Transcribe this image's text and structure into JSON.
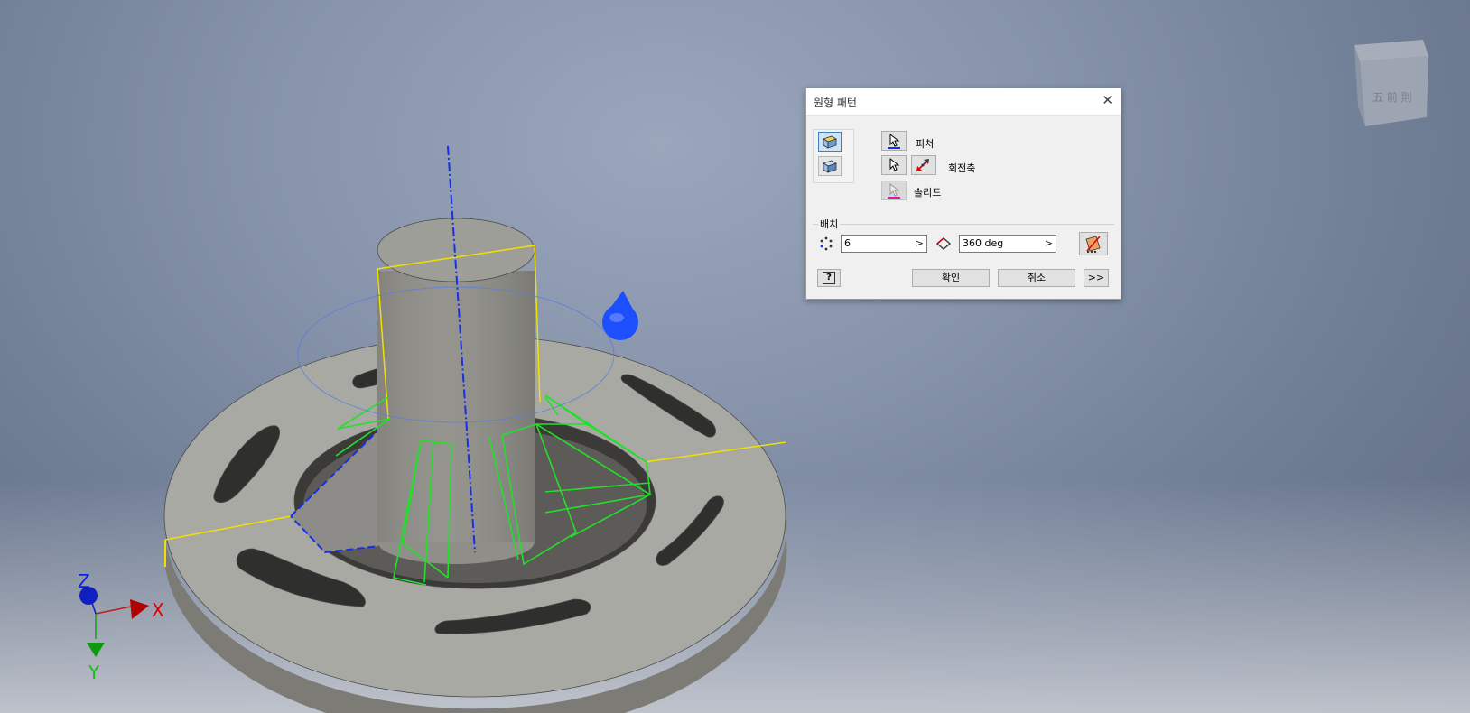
{
  "dialog": {
    "title": "원형 패턴",
    "close_glyph": "✕",
    "feature_label": "피쳐",
    "axis_label": "회전축",
    "solid_label": "솔리드",
    "placement_group_label": "배치",
    "count_value": "6",
    "angle_value": "360 deg",
    "field_arrow": ">",
    "ok_label": "확인",
    "cancel_label": "취소",
    "more_label": ">>",
    "help_glyph": "?"
  },
  "triad": {
    "x_label": "X",
    "y_label": "Y",
    "z_label": "Z"
  },
  "colors": {
    "selection_blue": "#1530e8",
    "preview_green": "#22e02a",
    "edge_yellow": "#f2e000",
    "part_gray": "#a7a7a2"
  },
  "icons": {
    "pattern_features": "pattern-features-icon",
    "pattern_solid": "pattern-solid-icon",
    "select_arrow": "select-arrow-icon",
    "flip_direction": "flip-direction-icon",
    "occurrence_count": "occurrence-count-icon",
    "occurrence_angle": "occurrence-angle-icon",
    "midplane": "midplane-icon",
    "help": "help-icon",
    "viewcube": "viewcube-icon"
  }
}
